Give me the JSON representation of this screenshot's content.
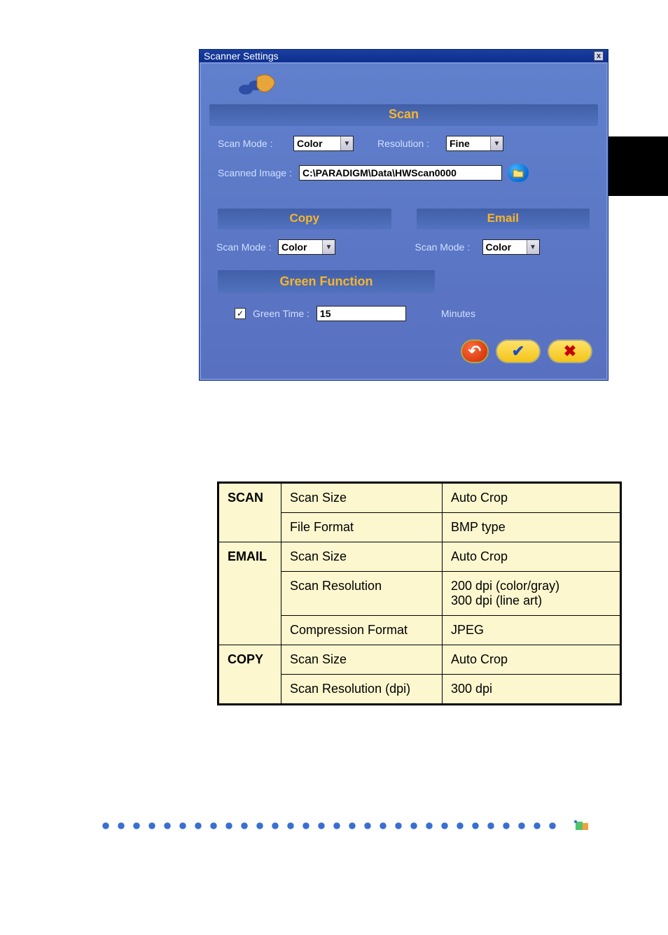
{
  "dialog": {
    "title": "Scanner Settings",
    "close_glyph": "x",
    "scan": {
      "header": "Scan",
      "mode_label": "Scan Mode :",
      "mode_value": "Color",
      "res_label": "Resolution :",
      "res_value": "Fine",
      "path_label": "Scanned Image :",
      "path_value": "C:\\PARADIGM\\Data\\HWScan0000"
    },
    "copy": {
      "header": "Copy",
      "mode_label": "Scan Mode :",
      "mode_value": "Color"
    },
    "email": {
      "header": "Email",
      "mode_label": "Scan Mode :",
      "mode_value": "Color"
    },
    "green": {
      "header": "Green Function",
      "time_label": "Green Time :",
      "time_value": "15",
      "unit": "Minutes",
      "checked_glyph": "✓"
    },
    "buttons": {
      "undo_glyph": "↶",
      "ok_glyph": "✔",
      "cancel_glyph": "✖"
    }
  },
  "spec_table": {
    "rows": [
      {
        "cat": "SCAN",
        "k": "Scan Size",
        "v": "Auto Crop"
      },
      {
        "cat": "",
        "k": "File Format",
        "v": "BMP type"
      },
      {
        "cat": "EMAIL",
        "k": "Scan Size",
        "v": "Auto Crop"
      },
      {
        "cat": "",
        "k": "Scan Resolution",
        "v": "200 dpi (color/gray)\n300 dpi (line art)"
      },
      {
        "cat": "",
        "k": "Compression Format",
        "v": "JPEG"
      },
      {
        "cat": "COPY",
        "k": "Scan Size",
        "v": "Auto Crop"
      },
      {
        "cat": "",
        "k": "Scan Resolution (dpi)",
        "v": "300 dpi"
      }
    ]
  }
}
